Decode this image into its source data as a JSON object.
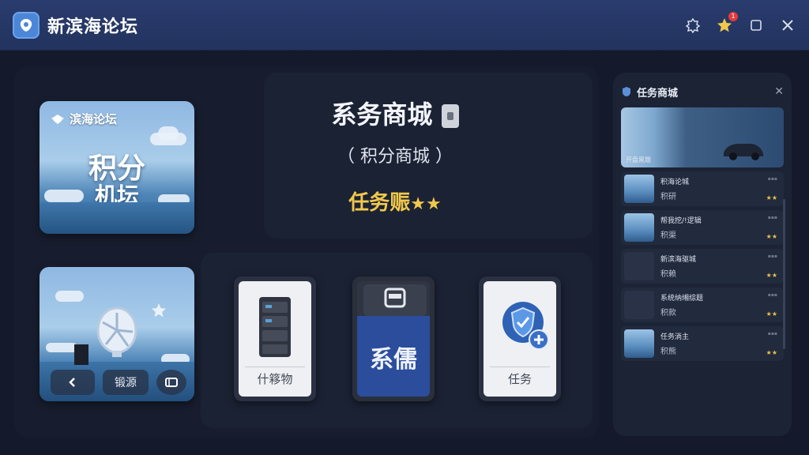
{
  "window": {
    "title": "新滨海论坛",
    "notification_count": "1"
  },
  "hero": {
    "brand": "滨海论坛",
    "big_line1": "积分",
    "big_line2": "机坛"
  },
  "center": {
    "title": "系务商城",
    "subtitle": "（ 积分商城 ）",
    "task": "任务赈",
    "stars": "★★"
  },
  "lower_tile": {
    "source_label": "锻源"
  },
  "cards": [
    {
      "label": "什簃物"
    },
    {
      "label": "系儒"
    },
    {
      "label": "任务"
    }
  ],
  "sidebar": {
    "title": "任务商城",
    "featured_label": "开盘黑题",
    "items": [
      {
        "title": "积海论城",
        "sub": "积研",
        "stars": "★★"
      },
      {
        "title": "帮我挖/!逻辑",
        "sub": "积渠",
        "stars": "★★"
      },
      {
        "title": "新滨海驱城",
        "sub": "积赖",
        "stars": "★★"
      },
      {
        "title": "系统纳缃综题",
        "sub": "积款",
        "stars": "★★"
      },
      {
        "title": "任务淌主",
        "sub": "积熊",
        "stars": "★★"
      }
    ]
  },
  "colors": {
    "titlebar": "#2a3c6e",
    "accent_gold": "#f1c84b",
    "background": "#141a2b"
  }
}
